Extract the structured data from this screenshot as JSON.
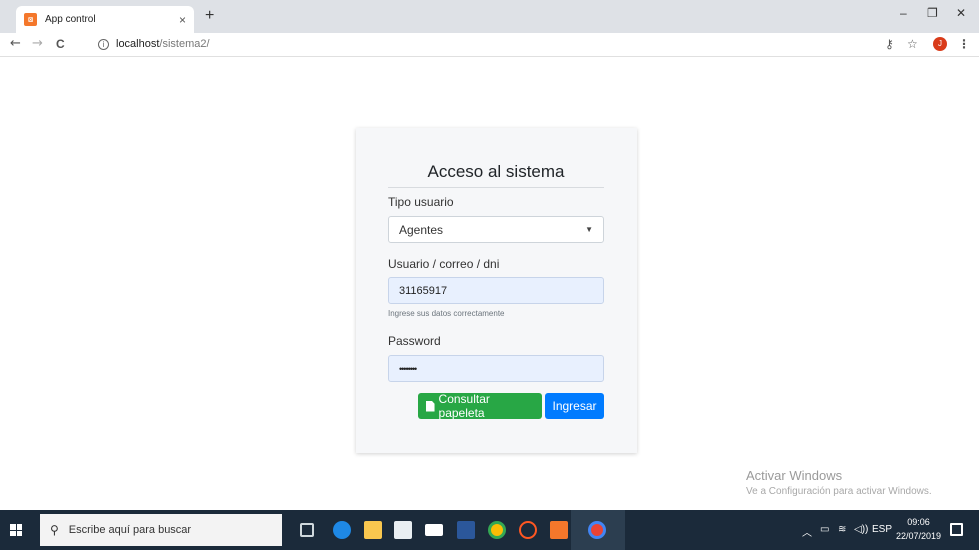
{
  "browser": {
    "tab_title": "App control",
    "tab_close": "×",
    "new_tab": "+",
    "window_controls": {
      "minimize": "–",
      "restore": "❐",
      "close": "✕"
    },
    "nav": {
      "back": "←",
      "forward": "→",
      "reload": "C"
    },
    "address": {
      "host": "localhost",
      "path": "/sistema2/"
    },
    "avatar_letter": "J"
  },
  "login": {
    "title": "Acceso al sistema",
    "user_type_label": "Tipo usuario",
    "user_type_selected": "Agentes",
    "user_label": "Usuario / correo / dni",
    "user_value": "31165917",
    "user_help": "Ingrese sus datos correctamente",
    "password_label": "Password",
    "password_mask": "••••••••",
    "btn_consult": "Consultar papeleta",
    "btn_login": "Ingresar"
  },
  "watermark": {
    "title": "Activar Windows",
    "subtitle": "Ve a Configuración para activar Windows."
  },
  "taskbar": {
    "search_placeholder": "Escribe aquí para buscar",
    "tray_lang": "ESP",
    "clock_time": "09:06",
    "clock_date": "22/07/2019"
  },
  "colors": {
    "primary": "#007bff",
    "success": "#28a745",
    "autofill": "#e8f0fe",
    "taskbar": "#1b2a3a"
  }
}
